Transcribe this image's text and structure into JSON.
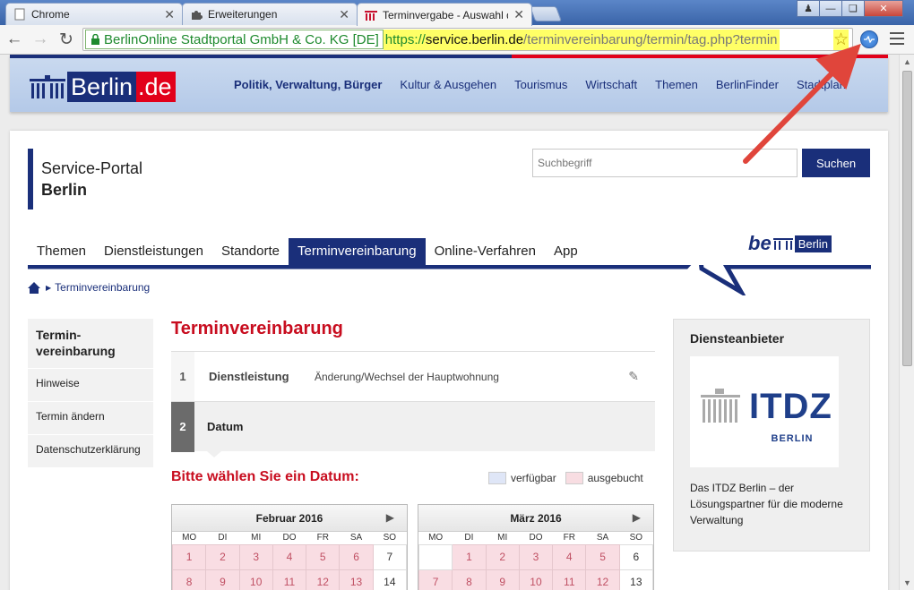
{
  "browser": {
    "tabs": [
      {
        "title": "Chrome",
        "icon": "chrome-page-icon"
      },
      {
        "title": "Erweiterungen",
        "icon": "puzzle-icon"
      },
      {
        "title": "Terminvergabe - Auswahl des",
        "icon": "berlin-favicon"
      }
    ],
    "ev_label": "BerlinOnline Stadtportal GmbH & Co. KG [DE]",
    "url_scheme": "https://",
    "url_host": "service.berlin.de",
    "url_path": "/terminvereinbarung/termin/tag.php?termin"
  },
  "site": {
    "logo_word": "Berlin",
    "logo_tld": ".de",
    "topnav": [
      "Politik, Verwaltung, Bürger",
      "Kultur & Ausgehen",
      "Tourismus",
      "Wirtschaft",
      "Themen",
      "BerlinFinder",
      "Stadtplan"
    ]
  },
  "portal": {
    "title_line1": "Service-Portal",
    "title_line2": "Berlin",
    "search_placeholder": "Suchbegriff",
    "search_button": "Suchen",
    "nav": [
      "Themen",
      "Dienstleistungen",
      "Standorte",
      "Terminvereinbarung",
      "Online-Verfahren",
      "App"
    ],
    "be_word": "be",
    "be_berlin": "Berlin",
    "breadcrumb": "Terminvereinbarung"
  },
  "sidenav": {
    "head": "Termin-\nvereinbarung",
    "head_line1": "Termin-",
    "head_line2": "vereinbarung",
    "items": [
      "Hinweise",
      "Termin ändern",
      "Datenschutzerklärung"
    ]
  },
  "main": {
    "heading": "Terminvereinbarung",
    "step1_num": "1",
    "step1_label": "Dienstleistung",
    "step1_value": "Änderung/Wechsel der Hauptwohnung",
    "step2_num": "2",
    "step2_label": "Datum",
    "choose": "Bitte wählen Sie ein Datum:",
    "legend_free": "verfügbar",
    "legend_booked": "ausgebucht"
  },
  "calendars": [
    {
      "month": "Februar 2016",
      "weekdays": [
        "MO",
        "DI",
        "MI",
        "DO",
        "FR",
        "SA",
        "SO"
      ],
      "rows": [
        [
          "1",
          "2",
          "3",
          "4",
          "5",
          "6",
          "7"
        ],
        [
          "8",
          "9",
          "10",
          "11",
          "12",
          "13",
          "14"
        ]
      ],
      "open": [
        "7",
        "14"
      ]
    },
    {
      "month": "März 2016",
      "weekdays": [
        "MO",
        "DI",
        "MI",
        "DO",
        "FR",
        "SA",
        "SO"
      ],
      "rows": [
        [
          "",
          "1",
          "2",
          "3",
          "4",
          "5",
          "6"
        ],
        [
          "7",
          "8",
          "9",
          "10",
          "11",
          "12",
          "13"
        ]
      ],
      "open": [
        "",
        "6",
        "13"
      ]
    }
  ],
  "provider": {
    "heading": "Diensteanbieter",
    "logo_text": "ITDZ",
    "logo_sub": "BERLIN",
    "text": "Das ITDZ Berlin – der Lösungspartner für die moderne Verwaltung"
  },
  "colors": {
    "accent": "#1a2f7a",
    "red": "#c80d1f",
    "booked": "#f9dde3",
    "free": "#dfe6f7",
    "arrow": "#e0453b"
  }
}
